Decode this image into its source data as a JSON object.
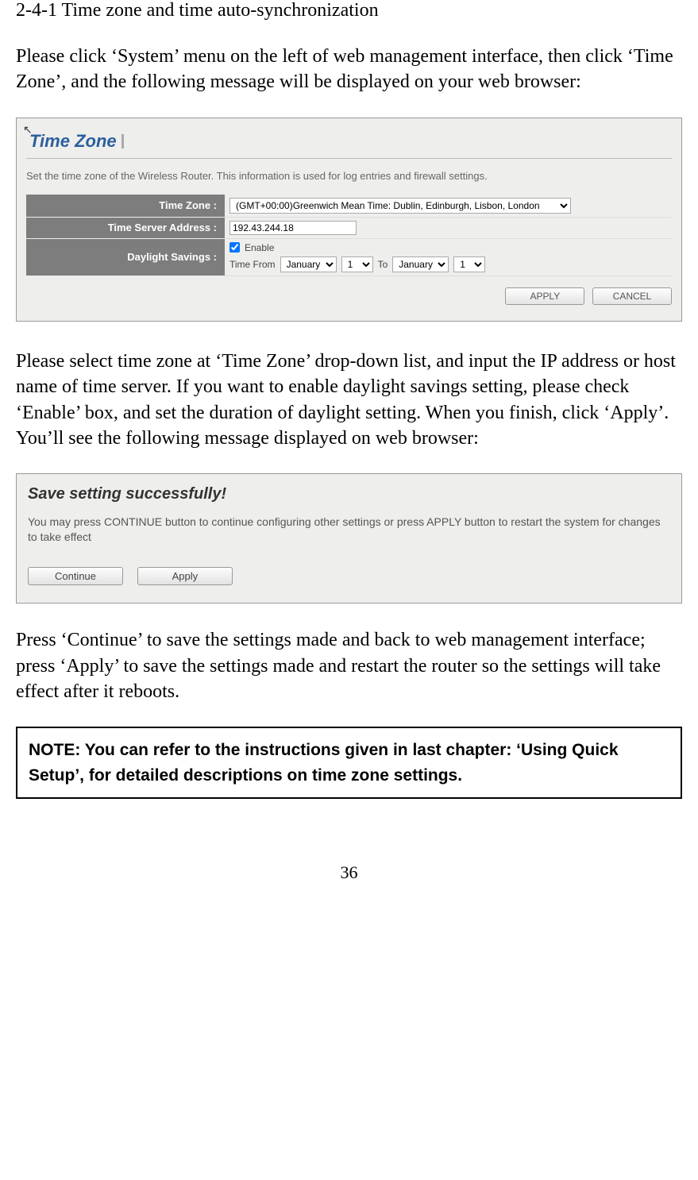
{
  "heading": "2-4-1 Time zone and time auto-synchronization",
  "para1": "Please click ‘System’ menu on the left of web management interface, then click ‘Time Zone’, and the following message will be displayed on your web browser:",
  "screenshot1": {
    "title": "Time Zone",
    "description": "Set the time zone of the Wireless Router. This information is used for log entries and firewall settings.",
    "labels": {
      "timezone": "Time Zone :",
      "timeserver": "Time Server Address :",
      "daylight": "Daylight Savings :"
    },
    "timezone_value": "(GMT+00:00)Greenwich Mean Time: Dublin, Edinburgh, Lisbon, London",
    "timeserver_value": "192.43.244.18",
    "enable_label": "Enable",
    "timefrom_label": "Time From",
    "to_label": "To",
    "month_value": "January",
    "day_value": "1",
    "apply": "APPLY",
    "cancel": "CANCEL"
  },
  "para2": "Please select time zone at ‘Time Zone’ drop-down list, and input the IP address or host name of time server. If you want to enable daylight savings setting, please check ‘Enable’ box, and set the duration of daylight setting. When you finish, click ‘Apply’. You’ll see the following message displayed on web browser:",
  "screenshot2": {
    "title": "Save setting successfully!",
    "description": "You may press CONTINUE button to continue configuring other settings or press APPLY button to restart the system for changes to take effect",
    "continue": "Continue",
    "apply": "Apply"
  },
  "para3": "Press ‘Continue’ to save the settings made and back to web management interface; press ‘Apply’ to save the settings made and restart the router so the settings will take effect after it reboots.",
  "note": "NOTE: You can refer to the instructions given in last chapter: ‘Using Quick Setup’, for detailed descriptions on time zone settings.",
  "page_number": "36"
}
